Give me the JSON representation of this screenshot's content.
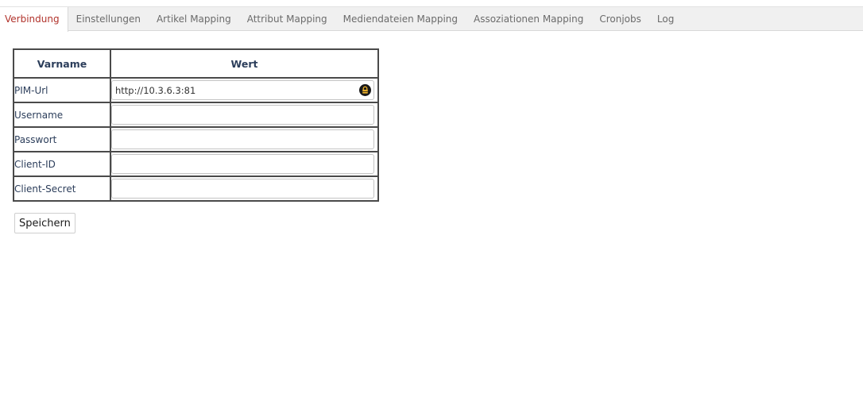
{
  "tabs": [
    {
      "label": "Verbindung",
      "active": true
    },
    {
      "label": "Einstellungen",
      "active": false
    },
    {
      "label": "Artikel Mapping",
      "active": false
    },
    {
      "label": "Attribut Mapping",
      "active": false
    },
    {
      "label": "Mediendateien Mapping",
      "active": false
    },
    {
      "label": "Assoziationen Mapping",
      "active": false
    },
    {
      "label": "Cronjobs",
      "active": false
    },
    {
      "label": "Log",
      "active": false
    }
  ],
  "table": {
    "headers": {
      "name": "Varname",
      "value": "Wert"
    },
    "rows": [
      {
        "label": "PIM-Url",
        "value": "http://10.3.6.3:81",
        "icon": "lock-icon"
      },
      {
        "label": "Username",
        "value": ""
      },
      {
        "label": "Passwort",
        "value": ""
      },
      {
        "label": "Client-ID",
        "value": ""
      },
      {
        "label": "Client-Secret",
        "value": ""
      }
    ]
  },
  "save_button": {
    "label": "Speichern"
  },
  "colors": {
    "active_tab_text": "#b1322b",
    "tab_text": "#6b6b6b",
    "tabbar_bg": "#f0f0f0",
    "label_text": "#2c3e5b",
    "table_border": "#4a4a4a",
    "lock_icon_bg": "#1a1a1a",
    "lock_icon_fg": "#f0b429"
  }
}
